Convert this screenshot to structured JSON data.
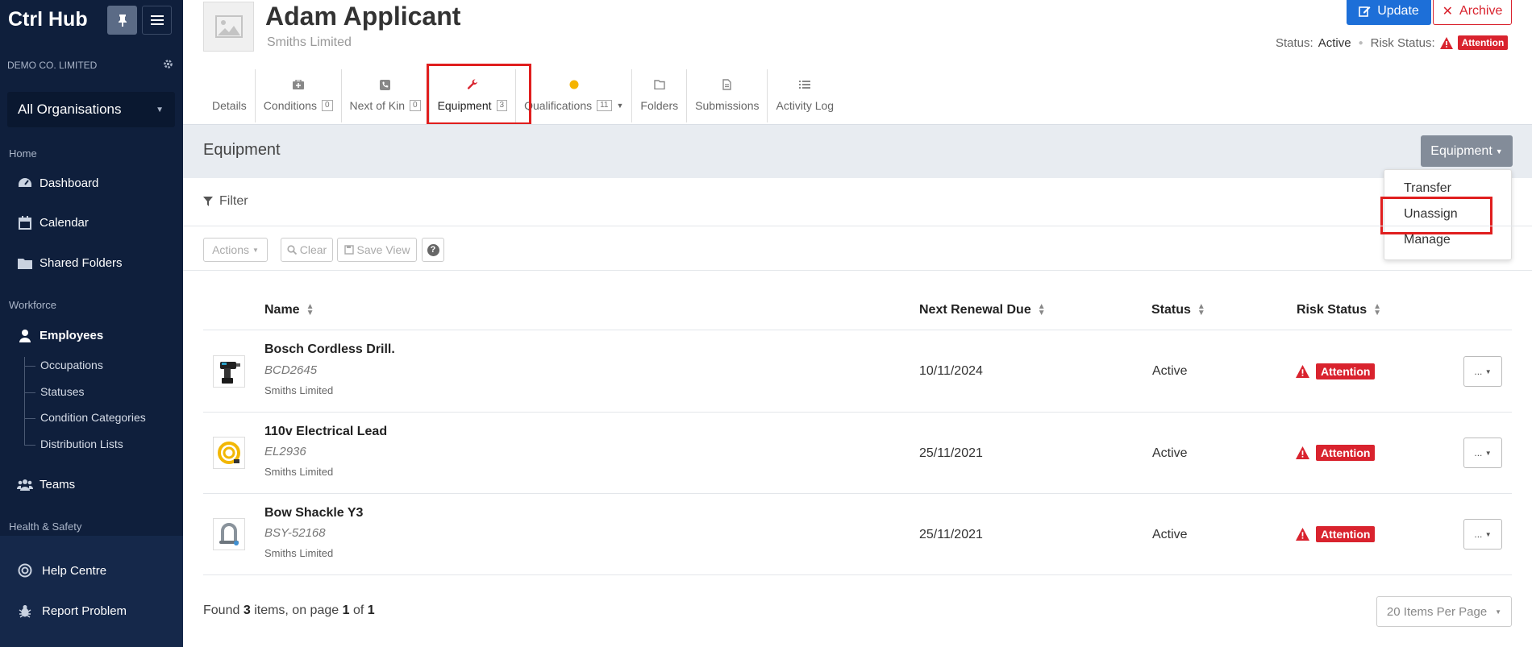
{
  "sidebar": {
    "brand": "Ctrl Hub",
    "org_name": "DEMO CO. LIMITED",
    "org_select": "All Organisations",
    "sections": {
      "home": "Home",
      "workforce": "Workforce",
      "health_safety": "Health & Safety"
    },
    "home_items": [
      {
        "label": "Dashboard",
        "icon": "dashboard-icon"
      },
      {
        "label": "Calendar",
        "icon": "calendar-icon"
      },
      {
        "label": "Shared Folders",
        "icon": "folder-icon"
      }
    ],
    "employees": "Employees",
    "sub_items": [
      "Occupations",
      "Statuses",
      "Condition Categories",
      "Distribution Lists"
    ],
    "teams": "Teams",
    "help": "Help Centre",
    "report": "Report Problem"
  },
  "header": {
    "name": "Adam Applicant",
    "company": "Smiths Limited",
    "update_label": "Update",
    "archive_label": "Archive",
    "status_label": "Status:",
    "status_value": "Active",
    "risk_label": "Risk Status:",
    "risk_value": "Attention"
  },
  "tabs": [
    {
      "label": "Details"
    },
    {
      "label": "Conditions",
      "count": "0"
    },
    {
      "label": "Next of Kin",
      "count": "0"
    },
    {
      "label": "Equipment",
      "count": "3"
    },
    {
      "label": "Qualifications",
      "count": "11"
    },
    {
      "label": "Folders"
    },
    {
      "label": "Submissions"
    },
    {
      "label": "Activity Log"
    }
  ],
  "section": {
    "title": "Equipment",
    "button_label": "Equipment",
    "menu": [
      "Transfer",
      "Unassign",
      "Manage"
    ]
  },
  "filter_label": "Filter",
  "toolbar": {
    "actions": "Actions",
    "clear": "Clear",
    "save_view": "Save View",
    "help": "?"
  },
  "table": {
    "headers": [
      "Name",
      "Next Renewal Due",
      "Status",
      "Risk Status"
    ],
    "rows": [
      {
        "name": "Bosch Cordless Drill.",
        "code": "BCD2645",
        "company": "Smiths Limited",
        "renewal": "10/11/2024",
        "status": "Active",
        "risk": "Attention",
        "more": "..."
      },
      {
        "name": "110v Electrical Lead",
        "code": "EL2936",
        "company": "Smiths Limited",
        "renewal": "25/11/2021",
        "status": "Active",
        "risk": "Attention",
        "more": "..."
      },
      {
        "name": "Bow Shackle Y3",
        "code": "BSY-52168",
        "company": "Smiths Limited",
        "renewal": "25/11/2021",
        "status": "Active",
        "risk": "Attention",
        "more": "..."
      }
    ]
  },
  "footer": {
    "found_prefix": "Found",
    "found_count": "3",
    "found_mid": "items, on page",
    "page": "1",
    "of": "of",
    "pages": "1",
    "per_page": "20 Items Per Page"
  },
  "colors": {
    "sidebar_bg": "#0f1f3c",
    "primary": "#1d6fd8",
    "danger": "#d9232e",
    "highlight": "#e01e1e"
  }
}
